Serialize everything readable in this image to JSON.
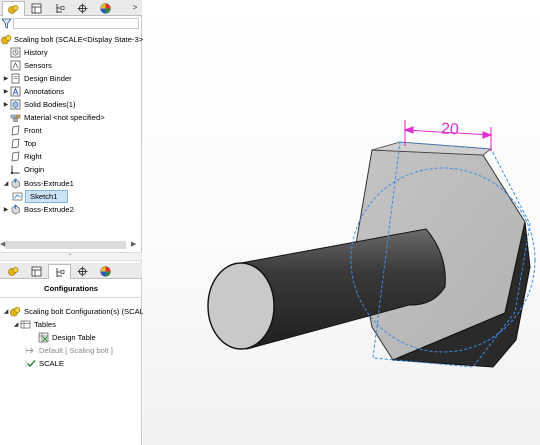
{
  "feature_tree": {
    "root_label": "Scaling bolt  (SCALE<Display State-3>)",
    "items": [
      {
        "label": "History",
        "icon": "history-icon",
        "expandable": false
      },
      {
        "label": "Sensors",
        "icon": "sensors-icon",
        "expandable": false
      },
      {
        "label": "Design Binder",
        "icon": "design-binder-icon",
        "expandable": true
      },
      {
        "label": "Annotations",
        "icon": "annotations-icon",
        "expandable": true
      },
      {
        "label": "Solid Bodies(1)",
        "icon": "solid-bodies-icon",
        "expandable": true
      },
      {
        "label": "Material <not specified>",
        "icon": "material-icon",
        "expandable": false
      },
      {
        "label": "Front",
        "icon": "plane-icon",
        "expandable": false
      },
      {
        "label": "Top",
        "icon": "plane-icon",
        "expandable": false
      },
      {
        "label": "Right",
        "icon": "plane-icon",
        "expandable": false
      },
      {
        "label": "Origin",
        "icon": "origin-icon",
        "expandable": false
      },
      {
        "label": "Boss-Extrude1",
        "icon": "extrude-icon",
        "expandable": true,
        "expanded": true
      },
      {
        "label": "Sketch1",
        "icon": "sketch-icon",
        "selected": true
      },
      {
        "label": "Boss-Extrude2",
        "icon": "extrude-icon",
        "expandable": true
      }
    ]
  },
  "configurations": {
    "title": "Configurations",
    "root_label": "Scaling bolt Configuration(s)  (SCAL",
    "tables_label": "Tables",
    "design_table_label": "Design Table",
    "default_label": "Default [ Scaling bolt ]",
    "scale_label": "SCALE"
  },
  "viewport": {
    "dimension_value": "20",
    "dimension_color": "#e030d0",
    "sketch_color": "#3a8ee8"
  }
}
